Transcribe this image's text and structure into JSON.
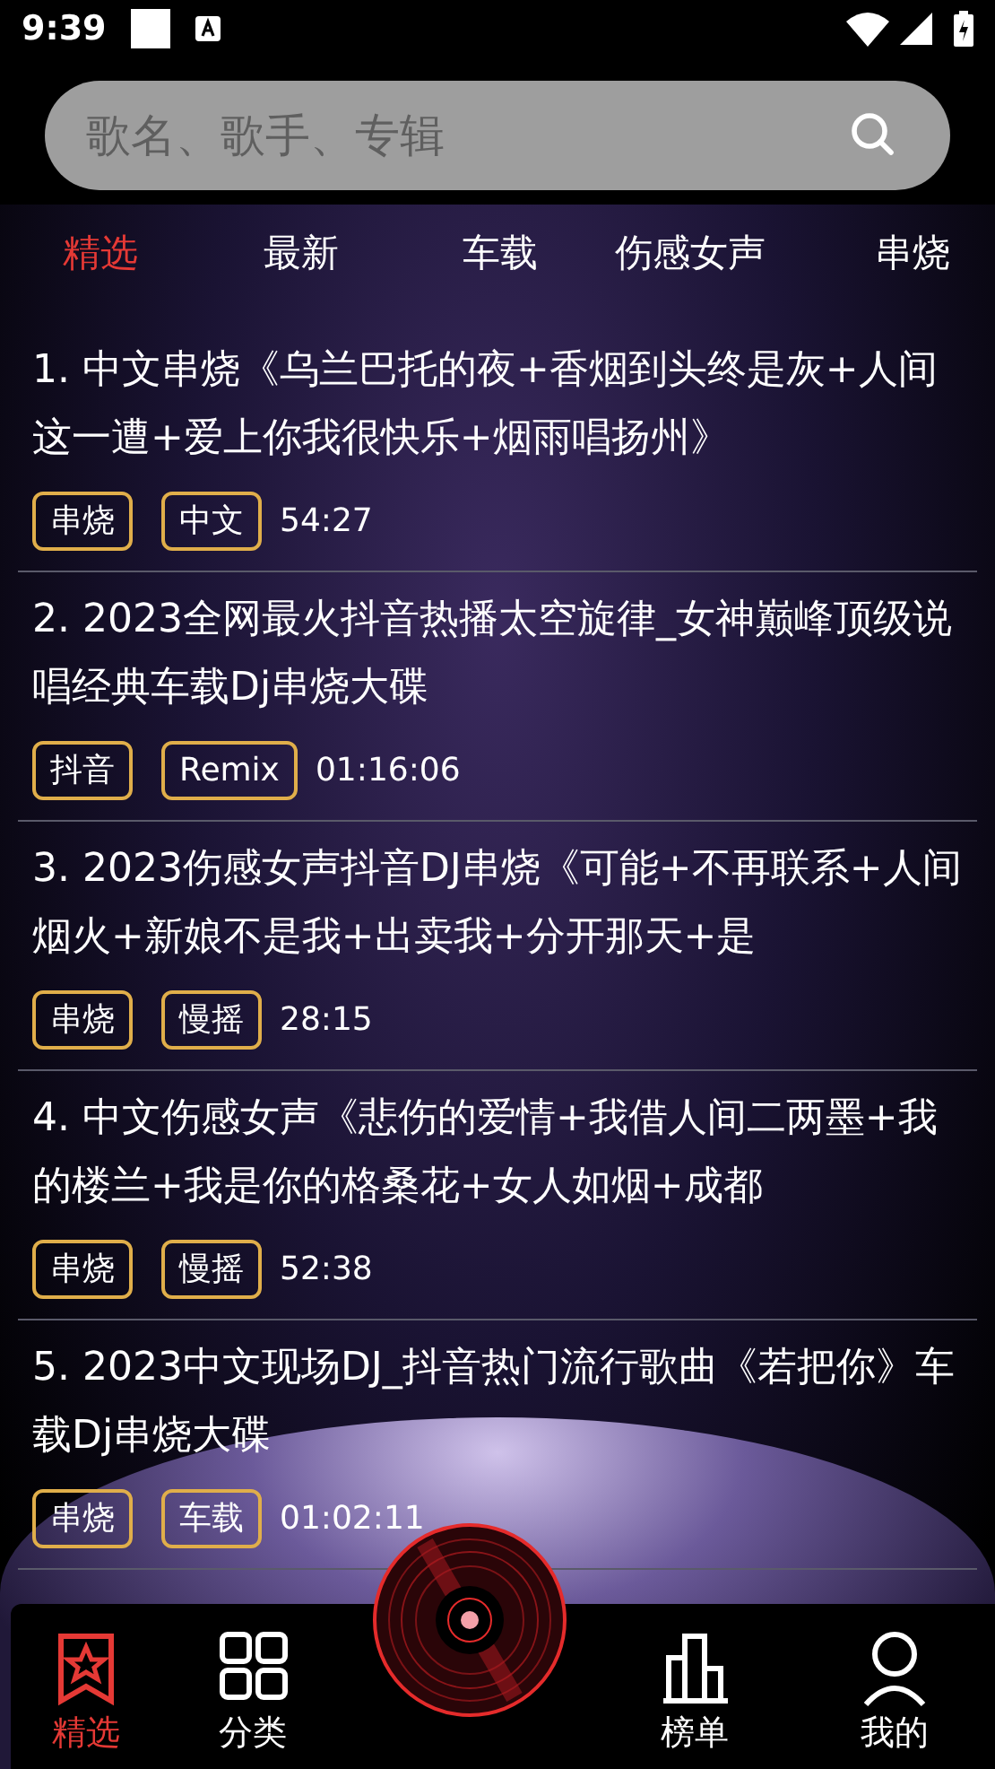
{
  "status_bar": {
    "time": "9:39"
  },
  "search": {
    "placeholder": "歌名、歌手、专辑"
  },
  "tabs": [
    {
      "label": "精选",
      "selected": true
    },
    {
      "label": "最新",
      "selected": false
    },
    {
      "label": "车载",
      "selected": false
    },
    {
      "label": "伤感女声",
      "selected": false
    },
    {
      "label": "串烧",
      "selected": false
    }
  ],
  "songs": [
    {
      "title": "1. 中文串烧《乌兰巴托的夜+香烟到头终是灰+人间这一遭+爱上你我很快乐+烟雨唱扬州》",
      "tags": [
        "串烧",
        "中文"
      ],
      "duration": "54:27"
    },
    {
      "title": "2. 2023全网最火抖音热播太空旋律_女神巅峰顶级说唱经典车载Dj串烧大碟",
      "tags": [
        "抖音",
        "Remix"
      ],
      "duration": "01:16:06"
    },
    {
      "title": "3. 2023伤感女声抖音DJ串烧《可能+不再联系+人间烟火+新娘不是我+出卖我+分开那天+是",
      "tags": [
        "串烧",
        "慢摇"
      ],
      "duration": "28:15"
    },
    {
      "title": "4. 中文伤感女声《悲伤的爱情+我借人间二两墨+我的楼兰+我是你的格桑花+女人如烟+成都",
      "tags": [
        "串烧",
        "慢摇"
      ],
      "duration": "52:38"
    },
    {
      "title": "5. 2023中文现场DJ_抖音热门流行歌曲《若把你》车载Dj串烧大碟",
      "tags": [
        "串烧",
        "车载"
      ],
      "duration": "01:02:11"
    }
  ],
  "bottom_nav": [
    {
      "label": "精选",
      "selected": true,
      "kind": "star"
    },
    {
      "label": "分类",
      "selected": false,
      "kind": "grid"
    },
    {
      "label": "榜单",
      "selected": false,
      "kind": "chart"
    },
    {
      "label": "我的",
      "selected": false,
      "kind": "person"
    }
  ]
}
